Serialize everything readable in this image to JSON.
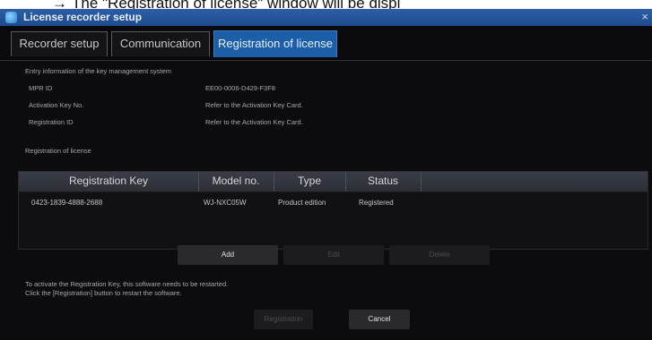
{
  "caption": {
    "arrow": "→",
    "text": "The \"Registration of license\" window will be displ"
  },
  "window": {
    "title": "License recorder setup",
    "close": "×"
  },
  "tabs": [
    {
      "label": "Recorder setup",
      "active": false
    },
    {
      "label": "Communication",
      "active": false
    },
    {
      "label": "Registration of license",
      "active": true
    }
  ],
  "entry_info": {
    "heading": "Entry information of the key management system",
    "rows": [
      {
        "label": "MPR ID",
        "value": "EE00-0006-D429-F3F8"
      },
      {
        "label": "Activation Key No.",
        "value": "Refer to the Activation Key Card."
      },
      {
        "label": "Registration ID",
        "value": "Refer to the Activation Key Card."
      }
    ]
  },
  "registration": {
    "heading": "Registration of license",
    "columns": [
      "Registration Key",
      "Model no.",
      "Type",
      "Status"
    ],
    "rows": [
      {
        "key": "0423-1839-4888-2688",
        "model": "WJ-NXC05W",
        "type": "Product edition",
        "status": "Registered"
      }
    ]
  },
  "buttons": {
    "add": "Add",
    "edit": "Edit",
    "delete": "Delete",
    "registration": "Registration",
    "cancel": "Cancel"
  },
  "notes": [
    "To activate the Registration Key, this software needs to be restarted.",
    "Click the [Registration] button to restart the software."
  ],
  "colors": {
    "background": "#0c0c0e",
    "titlebar": "#2d5fa6",
    "active_tab": "#1c5fa8",
    "grid_header": "#3a3d46"
  }
}
